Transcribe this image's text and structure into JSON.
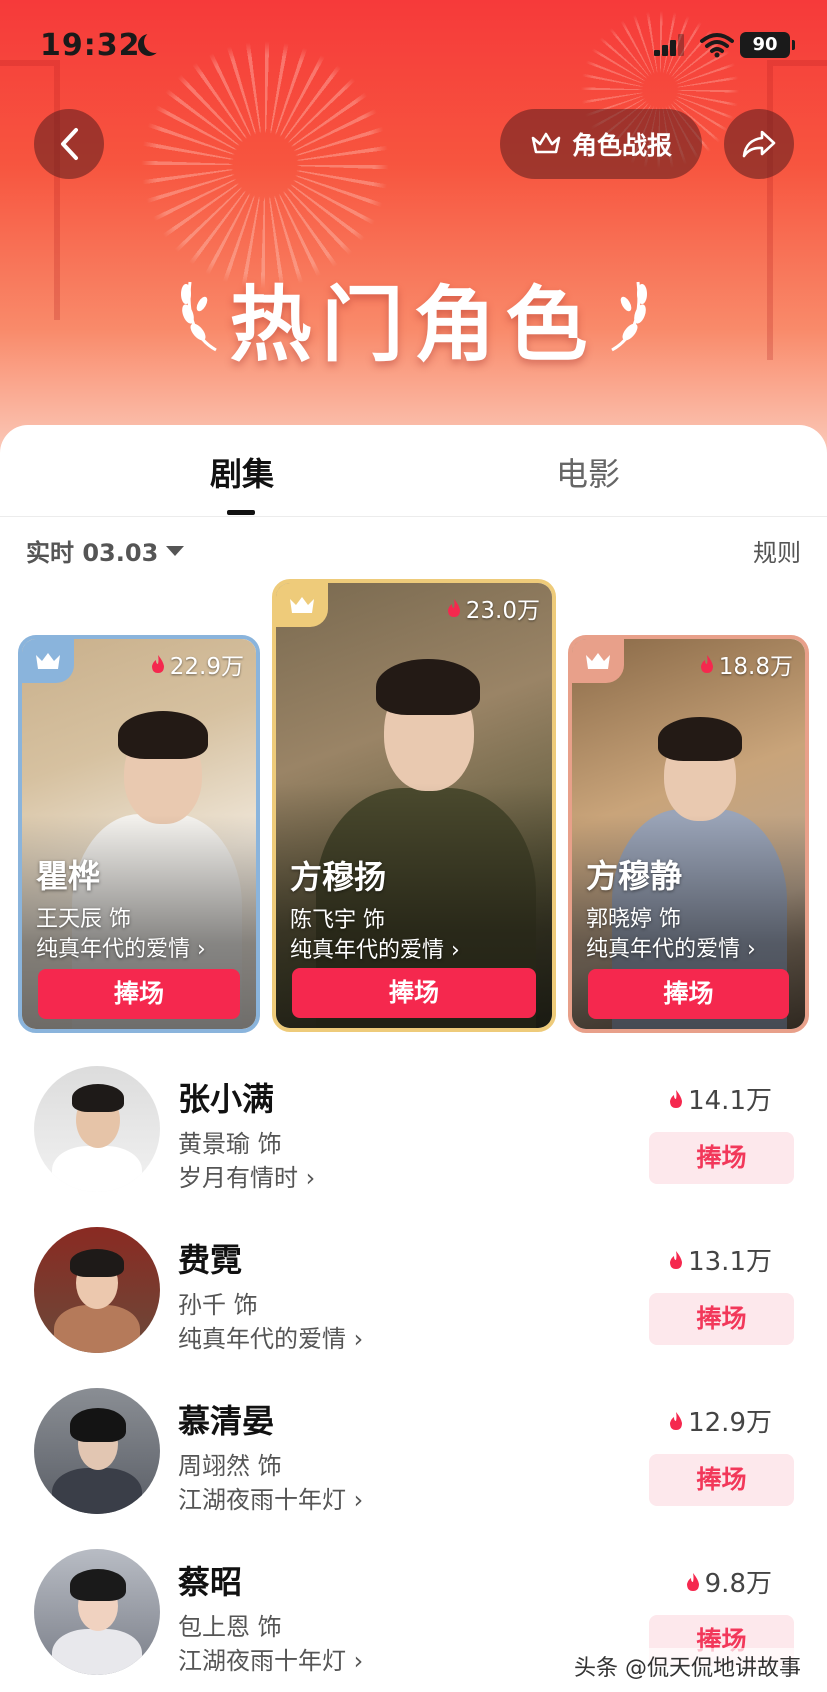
{
  "status_bar": {
    "time": "19:32",
    "battery": "90"
  },
  "header": {
    "report_label": "角色战报",
    "title": "热门角色"
  },
  "tabs": [
    {
      "label": "剧集",
      "active": true
    },
    {
      "label": "电影",
      "active": false
    }
  ],
  "filter": {
    "date_label": "实时 03.03",
    "rules_label": "规则"
  },
  "podium": [
    {
      "rank": 2,
      "name": "瞿桦",
      "actor": "王天辰 饰",
      "show": "纯真年代的爱情 ›",
      "heat": "22.9万",
      "button": "捧场",
      "accent": "#8ab4dc"
    },
    {
      "rank": 1,
      "name": "方穆扬",
      "actor": "陈飞宇 饰",
      "show": "纯真年代的爱情 ›",
      "heat": "23.0万",
      "button": "捧场",
      "accent": "#eecb7a"
    },
    {
      "rank": 3,
      "name": "方穆静",
      "actor": "郭晓婷 饰",
      "show": "纯真年代的爱情 ›",
      "heat": "18.8万",
      "button": "捧场",
      "accent": "#e8a08a"
    }
  ],
  "list": [
    {
      "name": "张小满",
      "actor": "黄景瑜 饰",
      "show": "岁月有情时 ›",
      "heat": "14.1万",
      "button": "捧场"
    },
    {
      "name": "费霓",
      "actor": "孙千 饰",
      "show": "纯真年代的爱情 ›",
      "heat": "13.1万",
      "button": "捧场"
    },
    {
      "name": "慕清晏",
      "actor": "周翊然 饰",
      "show": "江湖夜雨十年灯 ›",
      "heat": "12.9万",
      "button": "捧场"
    },
    {
      "name": "蔡昭",
      "actor": "包上恩 饰",
      "show": "江湖夜雨十年灯 ›",
      "heat": "9.8万",
      "button": "捧场"
    }
  ],
  "watermark": "头条 @侃天侃地讲故事",
  "colors": {
    "accent_red": "#f5284e",
    "header_red": "#f63a3a",
    "cheer_bg": "#fde8ec"
  }
}
